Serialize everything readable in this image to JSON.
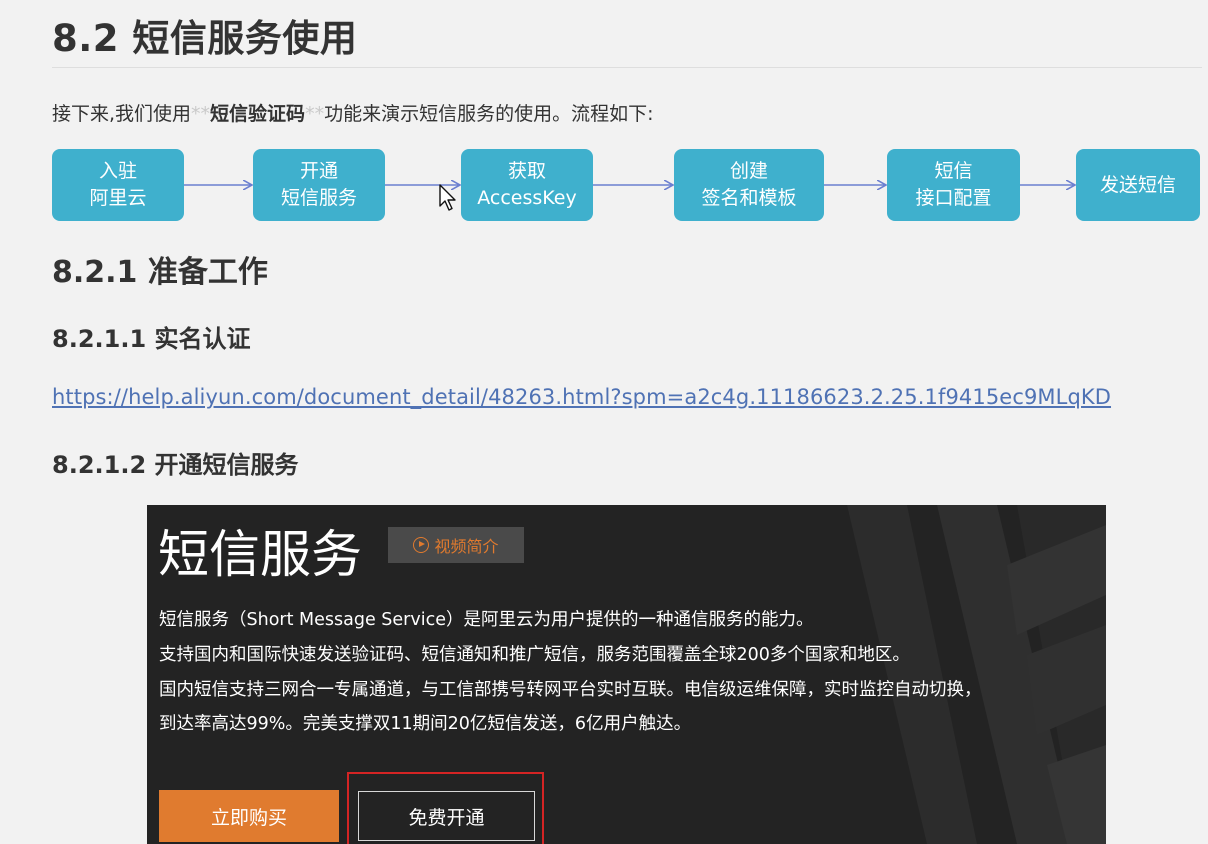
{
  "heading_main": "8.2 短信服务使用",
  "intro": {
    "before": "接下来,我们使用",
    "stars_open": "**",
    "bold": "短信验证码",
    "stars_close": "**",
    "after": "功能来演示短信服务的使用。流程如下:"
  },
  "flow": [
    {
      "line1": "入驻",
      "line2": "阿里云"
    },
    {
      "line1": "开通",
      "line2": "短信服务"
    },
    {
      "line1": "获取",
      "line2": "AccessKey"
    },
    {
      "line1": "创建",
      "line2": "签名和模板"
    },
    {
      "line1": "短信",
      "line2": "接口配置"
    },
    {
      "line1": "发送短信",
      "line2": ""
    }
  ],
  "section_prep": "8.2.1 准备工作",
  "section_realname": "8.2.1.1 实名认证",
  "link_url": "https://help.aliyun.com/document_detail/48263.html?spm=a2c4g.11186623.2.25.1f9415ec9MLqKD",
  "section_enable": "8.2.1.2 开通短信服务",
  "embedded": {
    "title": "短信服务",
    "video_label": "视频简介",
    "lines": [
      "短信服务（Short Message Service）是阿里云为用户提供的一种通信服务的能力。",
      "支持国内和国际快速发送验证码、短信通知和推广短信，服务范围覆盖全球200多个国家和地区。",
      "国内短信支持三网合一专属通道，与工信部携号转网平台实时互联。电信级运维保障，实时监控自动切换，",
      "到达率高达99%。完美支撑双11期间20亿短信发送，6亿用户触达。"
    ],
    "buy_label": "立即购买",
    "free_label": "免费开通"
  },
  "colors": {
    "flow_box": "#3fb0cd",
    "flow_arrow": "#6b7fd0",
    "link": "#4f72b4",
    "buy_button": "#e07b2f",
    "highlight_border": "#d42424",
    "embedded_bg": "#232323"
  }
}
